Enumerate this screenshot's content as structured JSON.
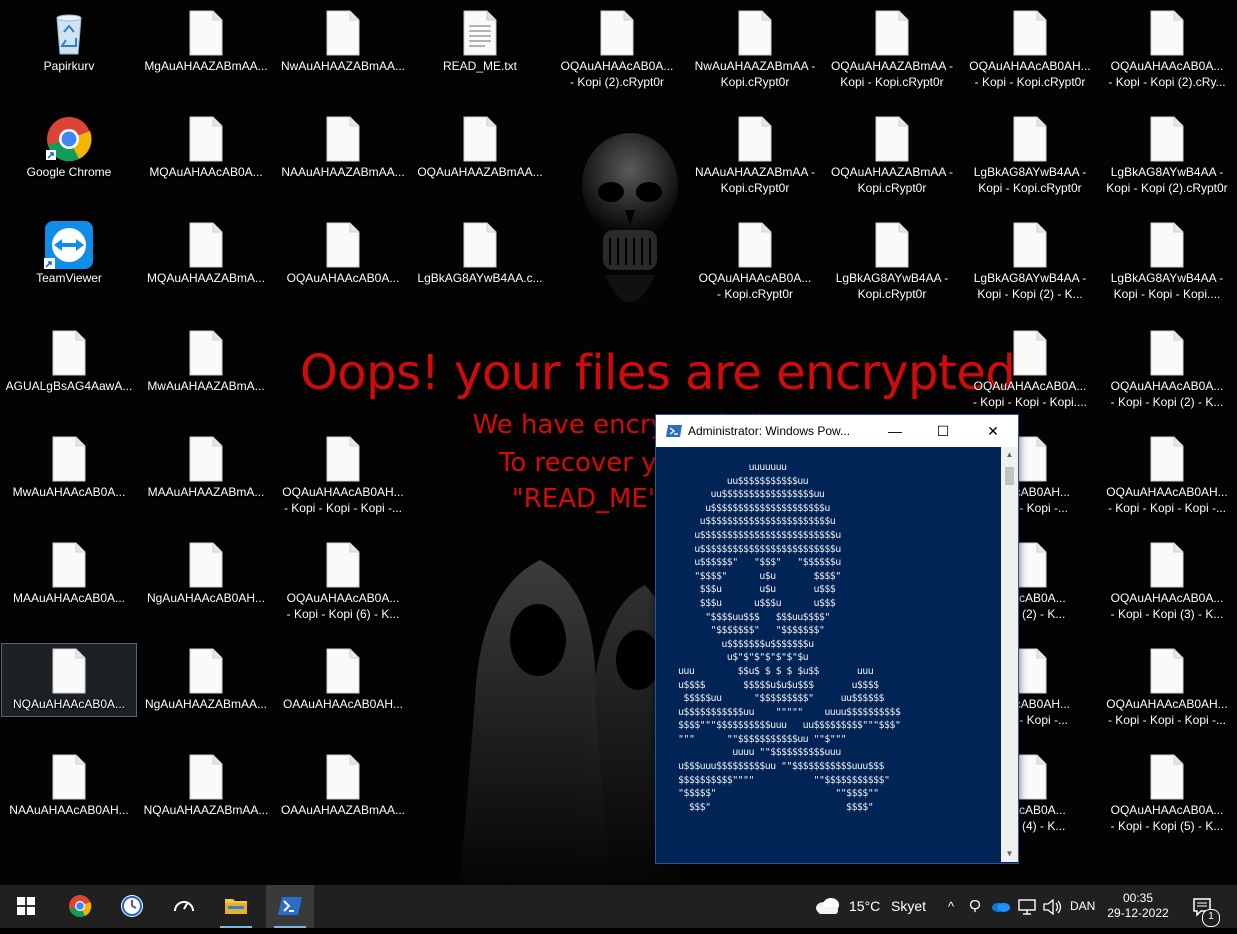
{
  "desktop": {
    "icons": [
      {
        "label": "Papirkurv",
        "label2": "",
        "kind": "recycle-bin"
      },
      {
        "label": "MgAuAHAAZABmAA...",
        "label2": "",
        "kind": "file"
      },
      {
        "label": "NwAuAHAAZABmAA...",
        "label2": "",
        "kind": "file"
      },
      {
        "label": "READ_ME.txt",
        "label2": "",
        "kind": "text-file"
      },
      {
        "label": "OQAuAHAAcAB0A...",
        "label2": "- Kopi (2).cRypt0r",
        "kind": "file"
      },
      {
        "label": "NwAuAHAAZABmAA -",
        "label2": "Kopi.cRypt0r",
        "kind": "file"
      },
      {
        "label": "OQAuAHAAZABmAA -",
        "label2": "Kopi - Kopi.cRypt0r",
        "kind": "file"
      },
      {
        "label": "OQAuAHAAcAB0AH...",
        "label2": "- Kopi - Kopi.cRypt0r",
        "kind": "file"
      },
      {
        "label": "OQAuAHAAcAB0A...",
        "label2": "- Kopi - Kopi (2).cRy...",
        "kind": "file"
      },
      {
        "label": "Google Chrome",
        "label2": "",
        "kind": "chrome"
      },
      {
        "label": "MQAuAHAAcAB0A...",
        "label2": "",
        "kind": "file"
      },
      {
        "label": "NAAuAHAAZABmAA...",
        "label2": "",
        "kind": "file"
      },
      {
        "label": "OQAuAHAAZABmAA...",
        "label2": "",
        "kind": "file"
      },
      {
        "label": "NAAuAHAAZABmAA -",
        "label2": "Kopi.cRypt0r",
        "kind": "file"
      },
      {
        "label": "OQAuAHAAZABmAA -",
        "label2": "Kopi.cRypt0r",
        "kind": "file"
      },
      {
        "label": "LgBkAG8AYwB4AA -",
        "label2": "Kopi - Kopi.cRypt0r",
        "kind": "file"
      },
      {
        "label": "LgBkAG8AYwB4AA -",
        "label2": "Kopi - Kopi (2).cRypt0r",
        "kind": "file"
      },
      {
        "label": "TeamViewer",
        "label2": "",
        "kind": "teamviewer"
      },
      {
        "label": "MQAuAHAAZABmA...",
        "label2": "",
        "kind": "file"
      },
      {
        "label": "OQAuAHAAcAB0A...",
        "label2": "",
        "kind": "file"
      },
      {
        "label": "LgBkAG8AYwB4AA.c...",
        "label2": "",
        "kind": "file"
      },
      {
        "label": "OQAuAHAAcAB0A...",
        "label2": "- Kopi.cRypt0r",
        "kind": "file"
      },
      {
        "label": "LgBkAG8AYwB4AA -",
        "label2": "Kopi.cRypt0r",
        "kind": "file"
      },
      {
        "label": "LgBkAG8AYwB4AA -",
        "label2": "Kopi - Kopi (2) - K...",
        "kind": "file"
      },
      {
        "label": "LgBkAG8AYwB4AA -",
        "label2": "Kopi - Kopi - Kopi....",
        "kind": "file"
      },
      {
        "label": "AGUALgBsAG4AawA...",
        "label2": "",
        "kind": "file"
      },
      {
        "label": "MwAuAHAAZABmA...",
        "label2": "",
        "kind": "file"
      },
      {
        "label": "OQAuAHAAcAB0A...",
        "label2": "- Kopi - Kopi - Kopi....",
        "kind": "file"
      },
      {
        "label": "OQAuAHAAcAB0A...",
        "label2": "- Kopi - Kopi (2) - K...",
        "kind": "file"
      },
      {
        "label": "MwAuAHAAcAB0A...",
        "label2": "",
        "kind": "file"
      },
      {
        "label": "MAAuAHAAZABmA...",
        "label2": "",
        "kind": "file"
      },
      {
        "label": "OQAuAHAAcAB0AH...",
        "label2": "- Kopi - Kopi - Kopi -...",
        "kind": "file"
      },
      {
        "label": "HAAcAB0AH...",
        "label2": "Kopi - Kopi -...",
        "kind": "file"
      },
      {
        "label": "OQAuAHAAcAB0AH...",
        "label2": "- Kopi - Kopi - Kopi -...",
        "kind": "file"
      },
      {
        "label": "MAAuAHAAcAB0A...",
        "label2": "",
        "kind": "file"
      },
      {
        "label": "NgAuAHAAcAB0AH...",
        "label2": "",
        "kind": "file"
      },
      {
        "label": "OQAuAHAAcAB0A...",
        "label2": "- Kopi - Kopi (6) - K...",
        "kind": "file"
      },
      {
        "label": "HAAcAB0A...",
        "label2": "Kopi (2) - K...",
        "kind": "file"
      },
      {
        "label": "OQAuAHAAcAB0A...",
        "label2": "- Kopi - Kopi (3) - K...",
        "kind": "file"
      },
      {
        "label": "NQAuAHAAcAB0A...",
        "label2": "",
        "kind": "file",
        "selected": true
      },
      {
        "label": "NgAuAHAAZABmAA...",
        "label2": "",
        "kind": "file"
      },
      {
        "label": "OAAuAHAAcAB0AH...",
        "label2": "",
        "kind": "file"
      },
      {
        "label": "HAAcAB0AH...",
        "label2": "Kopi - Kopi -...",
        "kind": "file"
      },
      {
        "label": "OQAuAHAAcAB0AH...",
        "label2": "- Kopi - Kopi - Kopi -...",
        "kind": "file"
      },
      {
        "label": "NAAuAHAAcAB0AH...",
        "label2": "",
        "kind": "file"
      },
      {
        "label": "NQAuAHAAZABmAA...",
        "label2": "",
        "kind": "file"
      },
      {
        "label": "OAAuAHAAZABmAA...",
        "label2": "",
        "kind": "file"
      },
      {
        "label": "HAAcAB0A...",
        "label2": "Kopi (4) - K...",
        "kind": "file"
      },
      {
        "label": "OQAuAHAAcAB0A...",
        "label2": "- Kopi - Kopi (5) - K...",
        "kind": "file"
      }
    ]
  },
  "ransom": {
    "title": "Oops! your files are encrypted",
    "line1": "We have encrypted all y",
    "line2": "To recover your files",
    "line3": "\"READ_ME\" file on"
  },
  "powershell": {
    "title": "Administrator: Windows Pow...",
    "minimize": "—",
    "maximize": "☐",
    "close": "✕",
    "console": "             uuuuuuu\n         uu$$$$$$$$$$$uu\n      uu$$$$$$$$$$$$$$$$$uu\n     u$$$$$$$$$$$$$$$$$$$$$u\n    u$$$$$$$$$$$$$$$$$$$$$$$u\n   u$$$$$$$$$$$$$$$$$$$$$$$$$u\n   u$$$$$$$$$$$$$$$$$$$$$$$$$u\n   u$$$$$$\"   \"$$$\"   \"$$$$$$u\n   \"$$$$\"      u$u       $$$$\"\n    $$$u       u$u       u$$$\n    $$$u      u$$$u      u$$$\n     \"$$$$uu$$$   $$$uu$$$$\"\n      \"$$$$$$$\"   \"$$$$$$$\"\n        u$$$$$$$u$$$$$$$u\n         u$\"$\"$\"$\"$\"$\"$u\nuuu        $$u$ $ $ $ $u$$       uuu\nu$$$$       $$$$$u$u$u$$$       u$$$$\n $$$$$uu      \"$$$$$$$$$\"     uu$$$$$$\nu$$$$$$$$$$$uu    \"\"\"\"\"    uuuu$$$$$$$$$$\n$$$$\"\"\"$$$$$$$$$$uuu   uu$$$$$$$$$\"\"\"$$$\"\n\"\"\"      \"\"$$$$$$$$$$$uu \"\"$\"\"\"\n          uuuu \"\"$$$$$$$$$$uuu\nu$$$uuu$$$$$$$$$uu \"\"$$$$$$$$$$$uuu$$$\n$$$$$$$$$$\"\"\"\"           \"\"$$$$$$$$$$$\"\n\"$$$$$\"                      \"\"$$$$\"\"\n  $$$\"                         $$$$\""
  },
  "taskbar": {
    "weather_temp": "15°C",
    "weather_desc": "Skyet",
    "language": "DAN",
    "time": "00:35",
    "date": "29-12-2022",
    "notifications": "1"
  }
}
